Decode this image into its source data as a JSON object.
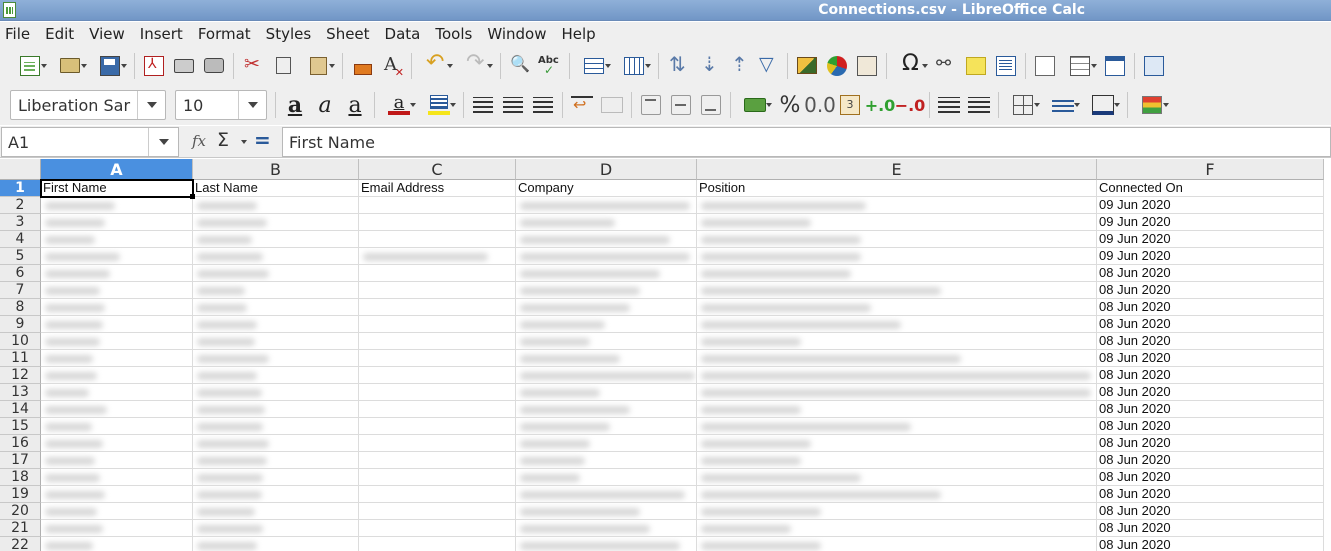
{
  "window": {
    "title": "Connections.csv - LibreOffice Calc"
  },
  "menu": [
    "File",
    "Edit",
    "View",
    "Insert",
    "Format",
    "Styles",
    "Sheet",
    "Data",
    "Tools",
    "Window",
    "Help"
  ],
  "toolbar2": {
    "font_name": "Liberation Sar",
    "font_size": "10"
  },
  "formula_bar": {
    "cell_reference": "A1",
    "formula": "First Name"
  },
  "columns": [
    "A",
    "B",
    "C",
    "D",
    "E",
    "F"
  ],
  "selected_column": "A",
  "header_row": [
    "First Name",
    "Last Name",
    "Email Address",
    "Company",
    "Position",
    "Connected On"
  ],
  "row_numbers": [
    "1",
    "2",
    "3",
    "4",
    "5",
    "6",
    "7",
    "8",
    "9",
    "10",
    "11",
    "12",
    "13",
    "14",
    "15",
    "16",
    "17",
    "18",
    "19",
    "20",
    "21",
    "22"
  ],
  "connected_on": [
    "09 Jun 2020",
    "09 Jun 2020",
    "09 Jun 2020",
    "09 Jun 2020",
    "08 Jun 2020",
    "08 Jun 2020",
    "08 Jun 2020",
    "08 Jun 2020",
    "08 Jun 2020",
    "08 Jun 2020",
    "08 Jun 2020",
    "08 Jun 2020",
    "08 Jun 2020",
    "08 Jun 2020",
    "08 Jun 2020",
    "08 Jun 2020",
    "08 Jun 2020",
    "08 Jun 2020",
    "08 Jun 2020",
    "08 Jun 2020",
    "08 Jun 2020"
  ],
  "colors": {
    "title_bar": "#7fa3d0",
    "selection": "#4a90e0",
    "ui_background": "#efefef"
  }
}
